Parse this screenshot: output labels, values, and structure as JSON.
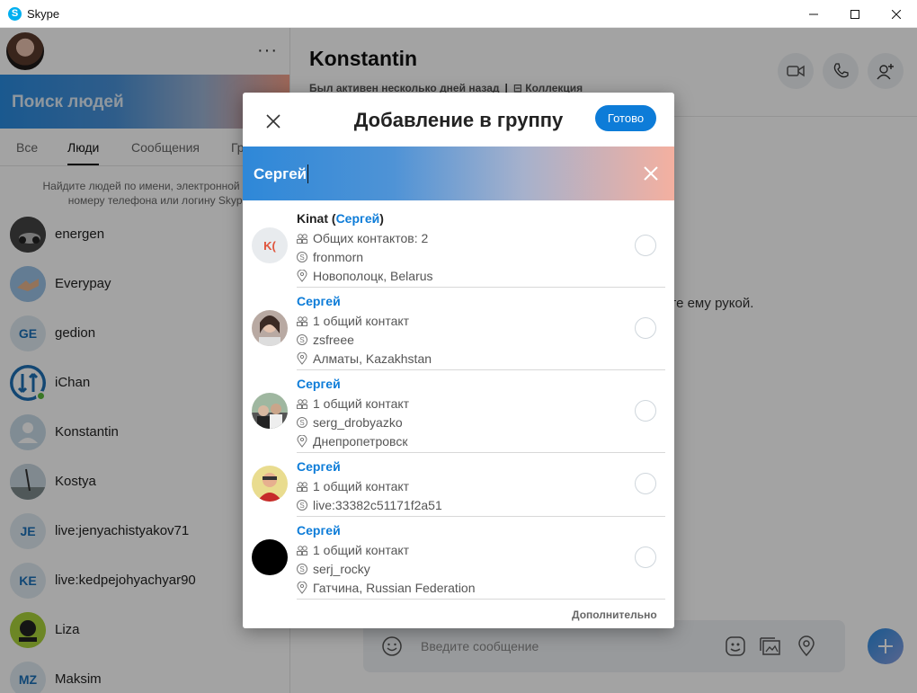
{
  "window": {
    "title": "Skype"
  },
  "sidebar": {
    "search_label": "Поиск людей",
    "tabs": [
      "Все",
      "Люди",
      "Сообщения",
      "Гр"
    ],
    "hint": "Найдите людей по имени, электронной почте, номеру телефона или логину Skype",
    "contacts": [
      {
        "name": "energen",
        "initials": ""
      },
      {
        "name": "Everypay",
        "initials": ""
      },
      {
        "name": "gedion",
        "initials": "GE"
      },
      {
        "name": "iChan",
        "initials": ""
      },
      {
        "name": "Konstantin",
        "initials": ""
      },
      {
        "name": "Kostya",
        "initials": ""
      },
      {
        "name": "live:jenyachistyakov71",
        "initials": "JE"
      },
      {
        "name": "live:kedpejohyachyar90",
        "initials": "KE"
      },
      {
        "name": "Liza",
        "initials": ""
      },
      {
        "name": "Maksim",
        "initials": "MZ"
      }
    ]
  },
  "conversation": {
    "name": "Konstantin",
    "status": "Был активен несколько дней назад",
    "collection": "Коллекция",
    "hint_partial": "ите ему рукой.",
    "composer_placeholder": "Введите сообщение"
  },
  "modal": {
    "title": "Добавление в группу",
    "done_label": "Готово",
    "search_query": "Сергей",
    "more_label": "Дополнительно",
    "results": [
      {
        "name_prefix": "Kinat (",
        "name_highlight": "Сергей",
        "name_suffix": ")",
        "avatar_initials": "K(",
        "mutual": "Общих контактов: 2",
        "skype": "fronmorn",
        "location": "Новополоцк, Belarus"
      },
      {
        "name_prefix": "",
        "name_highlight": "Сергей",
        "name_suffix": "",
        "avatar_initials": "",
        "mutual": "1 общий контакт",
        "skype": "zsfreee",
        "location": "Алматы, Kazakhstan"
      },
      {
        "name_prefix": "",
        "name_highlight": "Сергей",
        "name_suffix": "",
        "avatar_initials": "",
        "mutual": "1 общий контакт",
        "skype": "serg_drobyazko",
        "location": "Днепропетровск"
      },
      {
        "name_prefix": "",
        "name_highlight": "Сергей",
        "name_suffix": "",
        "avatar_initials": "",
        "mutual": "1 общий контакт",
        "skype": "live:33382c51171f2a51",
        "location": ""
      },
      {
        "name_prefix": "",
        "name_highlight": "Сергей",
        "name_suffix": "",
        "avatar_initials": "",
        "mutual": "1 общий контакт",
        "skype": "serj_rocky",
        "location": "Гатчина, Russian Federation"
      }
    ]
  },
  "colors": {
    "accent": "#0d7cd8",
    "online": "#5cba3c"
  }
}
